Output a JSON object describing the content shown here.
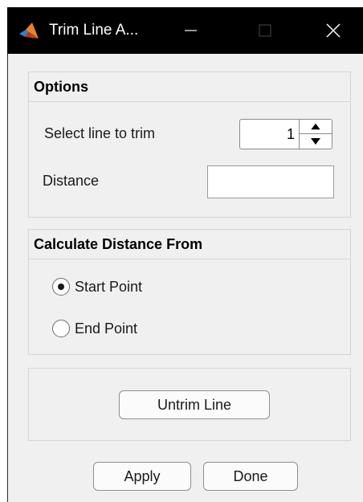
{
  "window": {
    "title": "Trim Line A...",
    "logo_icon": "matlab-logo-icon",
    "controls": [
      "minimize-icon",
      "maximize-icon",
      "close-icon"
    ]
  },
  "options": {
    "header": "Options",
    "line_label": "Select line to trim",
    "line_value": "1",
    "distance_label": "Distance",
    "distance_value": ""
  },
  "calc": {
    "header": "Calculate Distance From",
    "options": [
      {
        "label": "Start Point",
        "selected": true
      },
      {
        "label": "End Point",
        "selected": false
      }
    ]
  },
  "untrim": {
    "button_label": "Untrim Line"
  },
  "footer": {
    "apply_label": "Apply",
    "done_label": "Done"
  }
}
